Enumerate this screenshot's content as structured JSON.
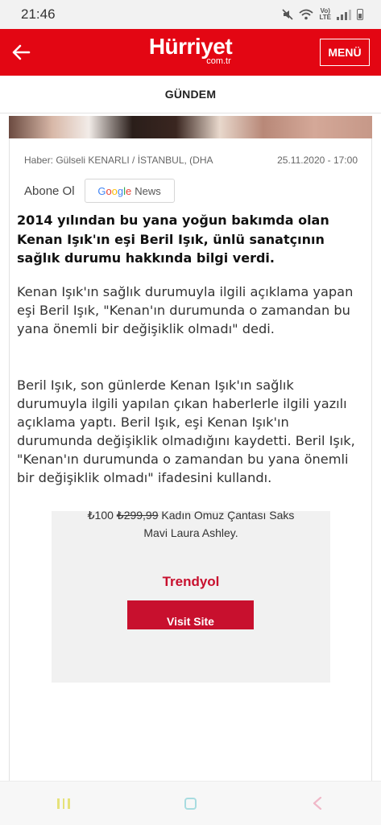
{
  "status_bar": {
    "time": "21:46",
    "icons": [
      "mute-icon",
      "wifi-icon",
      "volte-icon",
      "signal-icon",
      "battery-icon"
    ],
    "volte_label_1": "Vo)",
    "volte_label_2": "LTE"
  },
  "header": {
    "logo_main": "Hürriyet",
    "logo_sub": "com.tr",
    "menu_label": "MENÜ",
    "background": "#e30613"
  },
  "section": {
    "title": "GÜNDEM"
  },
  "article": {
    "byline": "Haber: Gülseli KENARLI / İSTANBUL, (DHA",
    "date": "25.11.2020 - 17:00",
    "follow_label": "Abone Ol",
    "google_news": {
      "g1": "G",
      "o1": "o",
      "o2": "o",
      "g2": "g",
      "l": "l",
      "e": "e",
      "rest": "News"
    },
    "lead": "2014 yılından bu yana yoğun bakımda olan Kenan Işık'ın eşi Beril Işık, ünlü sanatçının sağlık durumu hakkında bilgi verdi.",
    "paragraphs": [
      "Kenan Işık'ın sağlık durumuyla ilgili açıklama yapan eşi Beril Işık, \"Kenan'ın durumunda o zamandan bu yana önemli bir değişiklik olmadı\" dedi.",
      "Beril Işık, son günlerde Kenan Işık'ın sağlık durumuyla ilgili yapılan çıkan haberlerle ilgili yazılı açıklama yaptı. Beril Işık, eşi Kenan Işık'ın durumunda değişiklik olmadığını kaydetti. Beril Işık, \"Kenan'ın durumunda o zamandan bu yana önemli bir değişiklik olmadı\" ifadesini kullandı."
    ]
  },
  "ad": {
    "price": "₺100",
    "old_price": "₺299,99",
    "product_line1": "Kadın Omuz Çantası Saks",
    "product_line2": "Mavi Laura Ashley.",
    "brand": "Trendyol",
    "cta": "Visit Site",
    "brand_color": "#c8102e"
  },
  "nav_bar": {
    "icons": [
      "recent-apps-icon",
      "home-icon",
      "back-icon"
    ]
  }
}
